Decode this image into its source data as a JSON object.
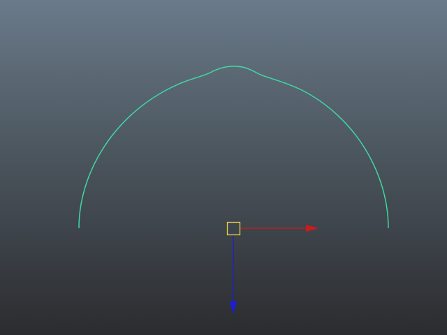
{
  "viewport": {
    "background_top": "#6a7a8a",
    "background_bottom": "#2b2c2f"
  },
  "curve": {
    "color": "#3fd9a4",
    "selected": false
  },
  "manipulator": {
    "tool": "move-manipulator",
    "pivot_color": "#e6d34a",
    "x_axis_color": "#cc1b1b",
    "z_axis_color": "#1c1cd9"
  }
}
